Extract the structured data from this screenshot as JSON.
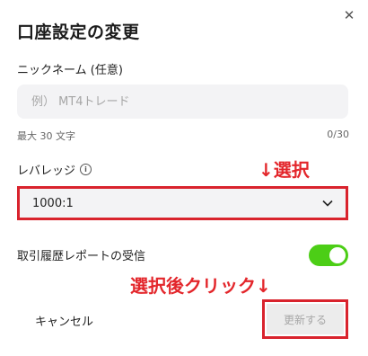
{
  "dialog": {
    "title": "口座設定の変更",
    "close_icon": "close-icon"
  },
  "nickname": {
    "label": "ニックネーム (任意)",
    "placeholder": "例） MT4トレード",
    "value": "",
    "hint": "最大 30 文字",
    "counter": "0/30"
  },
  "leverage": {
    "label": "レバレッジ",
    "info_icon": "info-icon",
    "info_glyph": "i",
    "selected": "1000:1",
    "dropdown_icon": "chevron-down-icon"
  },
  "report": {
    "label": "取引履歴レポートの受信",
    "enabled": true
  },
  "buttons": {
    "cancel": "キャンセル",
    "update": "更新する"
  },
  "annotations": {
    "select_note": "↓選択",
    "click_note": "選択後クリック↓"
  },
  "colors": {
    "highlight": "#d9232d",
    "annotation": "#e3262b",
    "toggle_on": "#4cce16",
    "disabled_text": "#a7a7a7"
  }
}
